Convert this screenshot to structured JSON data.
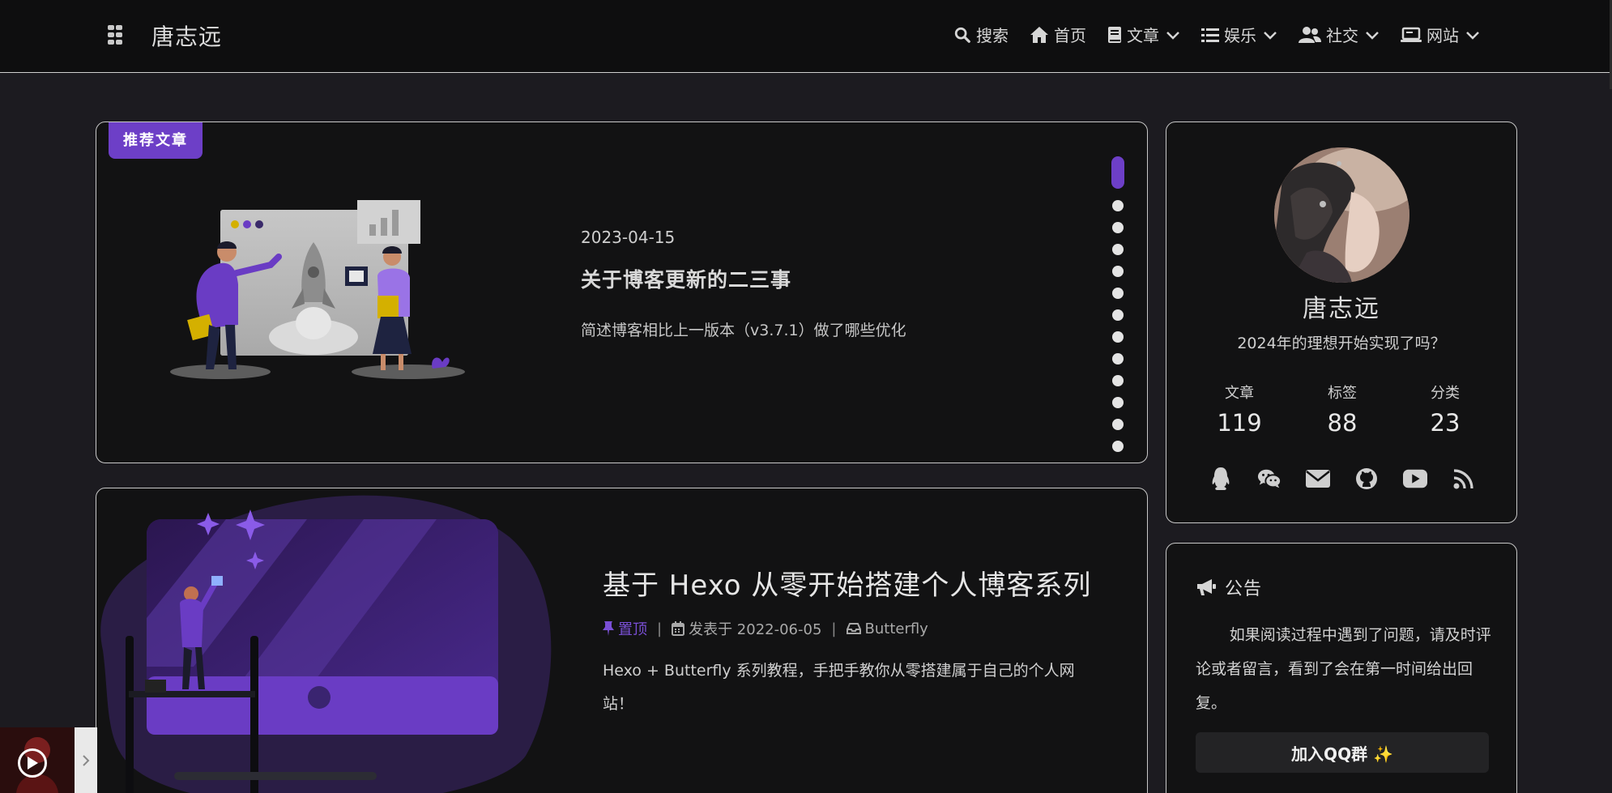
{
  "navbar": {
    "site_title": "唐志远",
    "menu": [
      {
        "label": "搜索",
        "icon": "search-icon"
      },
      {
        "label": "首页",
        "icon": "home-icon"
      },
      {
        "label": "文章",
        "icon": "book-icon",
        "dropdown": true
      },
      {
        "label": "娱乐",
        "icon": "list-icon",
        "dropdown": true
      },
      {
        "label": "社交",
        "icon": "users-icon",
        "dropdown": true
      },
      {
        "label": "网站",
        "icon": "laptop-icon",
        "dropdown": true
      }
    ]
  },
  "featured": {
    "badge": "推荐文章",
    "date": "2023-04-15",
    "title": "关于博客更新的二三事",
    "description": "简述博客相比上一版本（v3.7.1）做了哪些优化",
    "slide_count": 13,
    "active_slide": 1
  },
  "post": {
    "title": "基于 Hexo 从零开始搭建个人博客系列",
    "pinned_label": "置顶",
    "date_label": "发表于 2022-06-05",
    "category": "Butterfly",
    "description": "Hexo + Butterfly 系列教程，手把手教你从零搭建属于自己的个人网站！"
  },
  "profile": {
    "name": "唐志远",
    "description": "2024年的理想开始实现了吗？",
    "stats": [
      {
        "label": "文章",
        "value": "119"
      },
      {
        "label": "标签",
        "value": "88"
      },
      {
        "label": "分类",
        "value": "23"
      }
    ],
    "socials": [
      "qq-icon",
      "wechat-icon",
      "mail-icon",
      "github-icon",
      "youtube-icon",
      "rss-icon"
    ]
  },
  "announcement": {
    "title": "公告",
    "text": "如果阅读过程中遇到了问题，请及时评论或者留言，看到了会在第一时间给出回复。",
    "button": "加入QQ群 ✨"
  },
  "colors": {
    "accent": "#6d3fc7",
    "background": "#1c1b20",
    "card": "#121213",
    "navbar": "#0e0e0f"
  }
}
